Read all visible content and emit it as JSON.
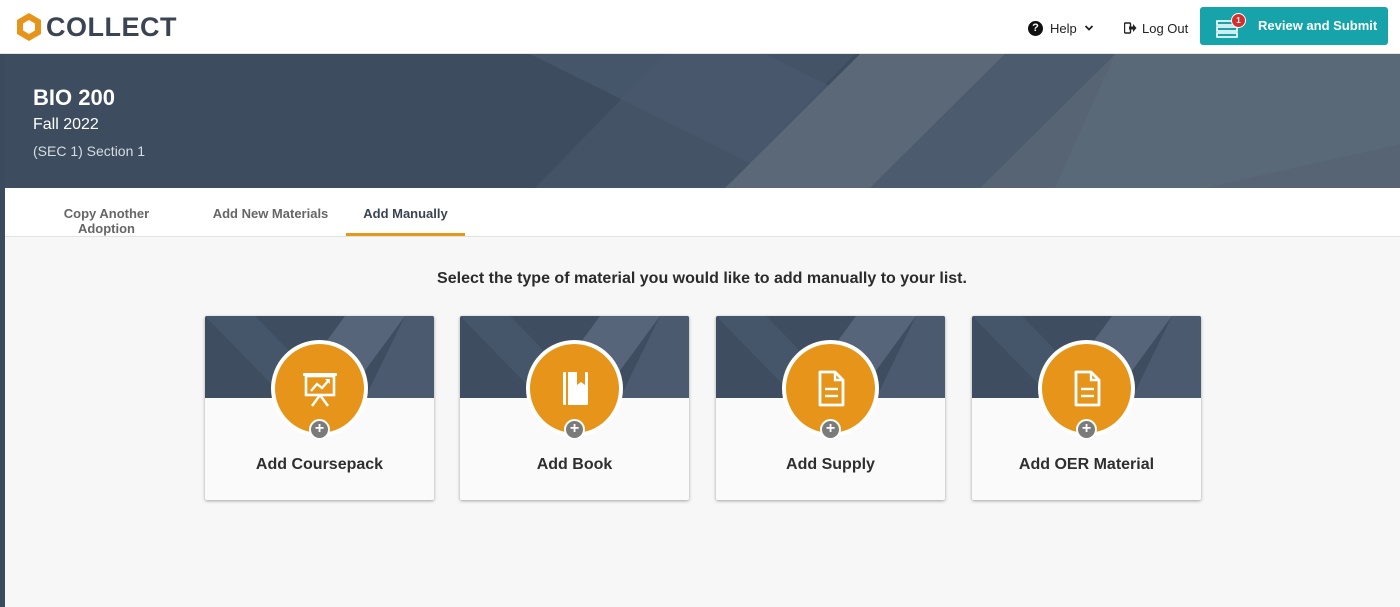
{
  "brand": {
    "name": "COLLECT",
    "logo_color": "#e6951a"
  },
  "nav": {
    "help_label": "Help",
    "logout_label": "Log Out",
    "review_label": "Review and Submit",
    "review_badge": "1",
    "accent": "#16a3a9"
  },
  "course": {
    "title": "BIO 200",
    "term": "Fall 2022",
    "section": "(SEC 1) Section 1"
  },
  "tabs": [
    {
      "label": "Copy Another Adoption",
      "active": false
    },
    {
      "label": "Add New Materials",
      "active": false
    },
    {
      "label": "Add Manually",
      "active": true
    }
  ],
  "main": {
    "prompt": "Select the type of material you would like to add manually to your list."
  },
  "cards": [
    {
      "label": "Add Coursepack",
      "icon": "presentation-chart-icon"
    },
    {
      "label": "Add Book",
      "icon": "book-icon"
    },
    {
      "label": "Add Supply",
      "icon": "document-icon"
    },
    {
      "label": "Add OER Material",
      "icon": "document-icon"
    }
  ],
  "colors": {
    "accent_orange": "#e6951a",
    "header_slate": "#3d4c5e"
  }
}
